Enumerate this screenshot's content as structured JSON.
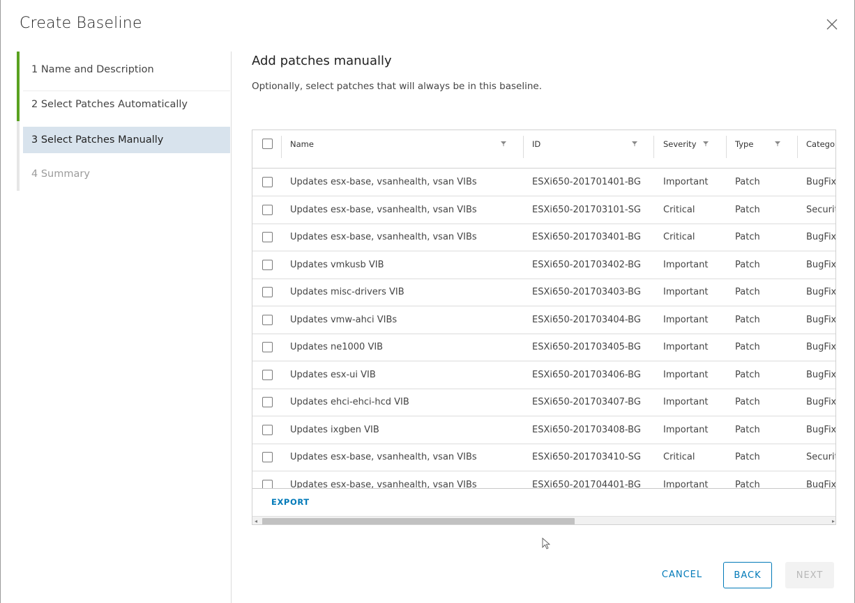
{
  "dialog": {
    "title": "Create Baseline"
  },
  "steps": [
    {
      "label": "1  Name and Description",
      "state": "done"
    },
    {
      "label": "2  Select Patches Automatically",
      "state": "done"
    },
    {
      "label": "3  Select Patches Manually",
      "state": "active"
    },
    {
      "label": "4  Summary",
      "state": "disabled"
    }
  ],
  "main": {
    "title": "Add patches manually",
    "subtitle": "Optionally, select patches that will always be in this baseline."
  },
  "table": {
    "columns": {
      "name": "Name",
      "id": "ID",
      "severity": "Severity",
      "type": "Type",
      "category": "Category"
    },
    "rows": [
      {
        "name": "Updates esx-base, vsanhealth, vsan VIBs",
        "id": "ESXi650-201701401-BG",
        "severity": "Important",
        "type": "Patch",
        "category": "BugFix"
      },
      {
        "name": "Updates esx-base, vsanhealth, vsan VIBs",
        "id": "ESXi650-201703101-SG",
        "severity": "Critical",
        "type": "Patch",
        "category": "Security"
      },
      {
        "name": "Updates esx-base, vsanhealth, vsan VIBs",
        "id": "ESXi650-201703401-BG",
        "severity": "Critical",
        "type": "Patch",
        "category": "BugFix"
      },
      {
        "name": "Updates vmkusb VIB",
        "id": "ESXi650-201703402-BG",
        "severity": "Important",
        "type": "Patch",
        "category": "BugFix"
      },
      {
        "name": "Updates misc-drivers VIB",
        "id": "ESXi650-201703403-BG",
        "severity": "Important",
        "type": "Patch",
        "category": "BugFix"
      },
      {
        "name": "Updates vmw-ahci VIBs",
        "id": "ESXi650-201703404-BG",
        "severity": "Important",
        "type": "Patch",
        "category": "BugFix"
      },
      {
        "name": "Updates ne1000 VIB",
        "id": "ESXi650-201703405-BG",
        "severity": "Important",
        "type": "Patch",
        "category": "BugFix"
      },
      {
        "name": "Updates esx-ui VIB",
        "id": "ESXi650-201703406-BG",
        "severity": "Important",
        "type": "Patch",
        "category": "BugFix"
      },
      {
        "name": "Updates ehci-ehci-hcd VIB",
        "id": "ESXi650-201703407-BG",
        "severity": "Important",
        "type": "Patch",
        "category": "BugFix"
      },
      {
        "name": "Updates ixgben VIB",
        "id": "ESXi650-201703408-BG",
        "severity": "Important",
        "type": "Patch",
        "category": "BugFix"
      },
      {
        "name": "Updates esx-base, vsanhealth, vsan VIBs",
        "id": "ESXi650-201703410-SG",
        "severity": "Critical",
        "type": "Patch",
        "category": "Security"
      },
      {
        "name": "Updates esx-base, vsanhealth, vsan VIBs",
        "id": "ESXi650-201704401-BG",
        "severity": "Important",
        "type": "Patch",
        "category": "BugFix"
      }
    ],
    "export_label": "EXPORT"
  },
  "footer": {
    "cancel_label": "CANCEL",
    "back_label": "BACK",
    "next_label": "NEXT"
  },
  "colors": {
    "accent": "#0079b8",
    "progress": "#5aa220",
    "active_step_bg": "#d8e3ed"
  }
}
